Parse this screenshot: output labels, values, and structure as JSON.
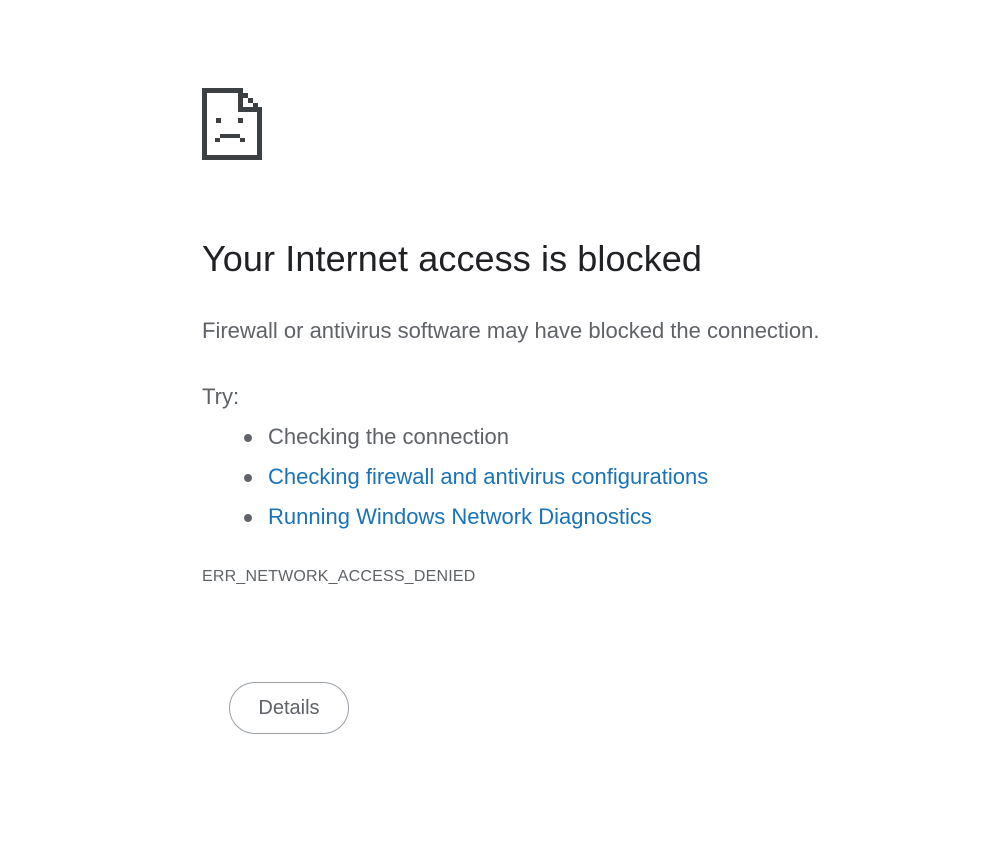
{
  "error": {
    "icon": "sad-page-icon",
    "title": "Your Internet access is blocked",
    "message": "Firewall or antivirus software may have blocked the connection.",
    "try_label": "Try:",
    "suggestions": [
      {
        "text": "Checking the connection",
        "is_link": false
      },
      {
        "text": "Checking firewall and antivirus configurations",
        "is_link": true
      },
      {
        "text": "Running Windows Network Diagnostics",
        "is_link": true
      }
    ],
    "code": "ERR_NETWORK_ACCESS_DENIED",
    "details_label": "Details"
  },
  "colors": {
    "title": "#202124",
    "body_text": "#5f6368",
    "link": "#1a73b8",
    "icon": "#3c4043",
    "button_border": "#9aa0a6"
  }
}
